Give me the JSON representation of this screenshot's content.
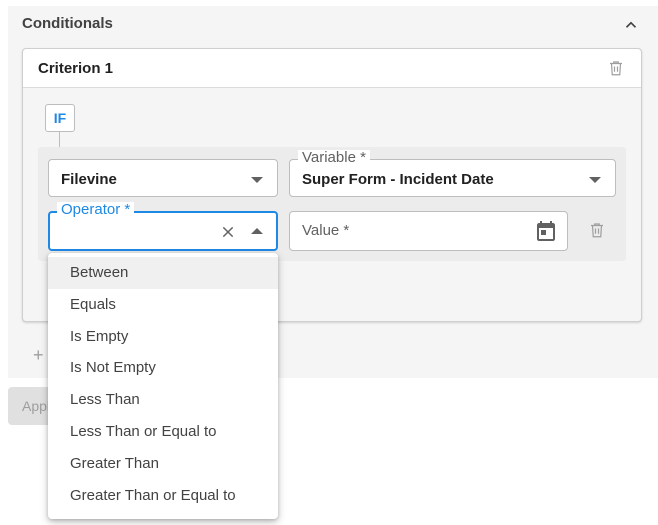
{
  "conditionals": {
    "title": "Conditionals",
    "criterion": {
      "title": "Criterion 1",
      "if_label": "IF",
      "source_select": {
        "value": "Filevine"
      },
      "variable_select": {
        "label": "Variable *",
        "value": "Super Form - Incident Date"
      },
      "operator_select": {
        "label": "Operator *",
        "value": ""
      },
      "value_input": {
        "placeholder": "Value *"
      }
    }
  },
  "apply_button": {
    "label": "Apply"
  },
  "operator_menu": {
    "options": [
      "Between",
      "Equals",
      "Is Empty",
      "Is Not Empty",
      "Less Than",
      "Less Than or Equal to",
      "Greater Than",
      "Greater Than or Equal to"
    ],
    "highlighted": "Between"
  },
  "icons": {
    "collapse": "chevron-up-icon",
    "delete": "trash-icon",
    "clear": "close-icon",
    "calendar": "calendar-icon",
    "add": "plus-icon"
  },
  "colors": {
    "accent": "#1e88e5",
    "panel_bg": "#f5f5f5",
    "text": "#212121"
  }
}
